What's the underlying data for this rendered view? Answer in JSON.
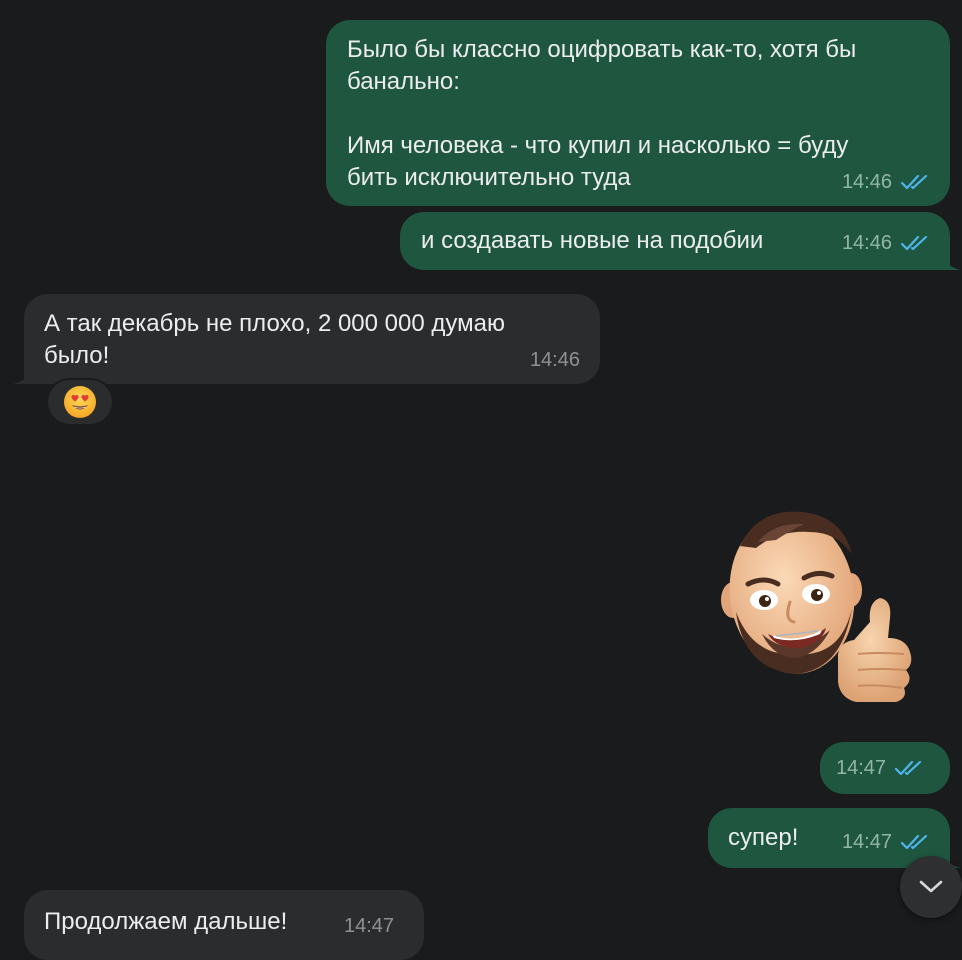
{
  "colors": {
    "background": "#1a1b1c",
    "outgoing_bubble": "#1e5640",
    "incoming_bubble": "#2b2c2e",
    "read_check": "#4fb6ec"
  },
  "messages": [
    {
      "direction": "outgoing",
      "text": "Было бы классно оцифровать как-то, хотя бы\nбанально:\n\nИмя человека - что купил и насколько = буду\nбить исключительно туда",
      "time": "14:46",
      "status_icon": "double-check-icon"
    },
    {
      "direction": "outgoing",
      "text": "и создавать новые на подобии",
      "time": "14:46",
      "status_icon": "double-check-icon"
    },
    {
      "direction": "incoming",
      "text": "А так декабрь не плохо, 2 000 000 думаю\nбыло!",
      "time": "14:46",
      "reaction": "heart-eyes-emoji"
    },
    {
      "direction": "outgoing",
      "type": "sticker",
      "sticker": "memoji-thumbs-up",
      "time": "14:47",
      "status_icon": "double-check-icon"
    },
    {
      "direction": "outgoing",
      "text": "супер!",
      "time": "14:47",
      "status_icon": "double-check-icon"
    },
    {
      "direction": "incoming",
      "text": "Продолжаем дальше!",
      "time": "14:47"
    }
  ],
  "scroll_button_icon": "chevron-down-icon"
}
